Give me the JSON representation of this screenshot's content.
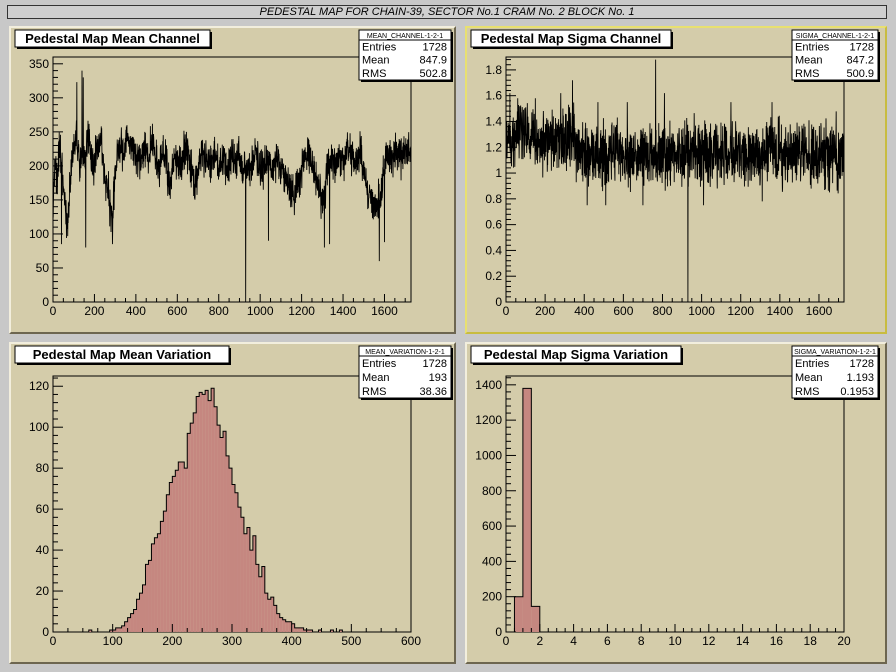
{
  "canvas_title": "PEDESTAL MAP FOR CHAIN-39, SECTOR No.1 CRAM No. 2 BLOCK No. 1",
  "colors": {
    "pad_bg": "#d4ccaa",
    "hist_fill": "#c58780",
    "line": "#000000",
    "selected_border": "#e8e070"
  },
  "chart_data": [
    {
      "type": "line",
      "title": "Pedestal Map Mean Channel",
      "stats": {
        "name": "MEAN_CHANNEL-1-2-1",
        "entries": "1728",
        "mean": "847.9",
        "rms": "502.8"
      },
      "xlim": [
        0,
        1728
      ],
      "ylim": [
        0,
        360
      ],
      "xticks": [
        0,
        200,
        400,
        600,
        800,
        1000,
        1200,
        1400,
        1600
      ],
      "yticks": [
        0,
        50,
        100,
        150,
        200,
        250,
        300,
        350
      ],
      "anchors": [
        [
          0,
          140
        ],
        [
          10,
          215
        ],
        [
          20,
          160
        ],
        [
          30,
          230
        ],
        [
          40,
          200
        ],
        [
          55,
          150
        ],
        [
          70,
          120
        ],
        [
          90,
          205
        ],
        [
          110,
          240
        ],
        [
          130,
          200
        ],
        [
          150,
          215
        ],
        [
          170,
          240
        ],
        [
          190,
          200
        ],
        [
          210,
          220
        ],
        [
          230,
          245
        ],
        [
          250,
          180
        ],
        [
          270,
          160
        ],
        [
          285,
          115
        ],
        [
          300,
          190
        ],
        [
          320,
          230
        ],
        [
          340,
          215
        ],
        [
          360,
          245
        ],
        [
          380,
          230
        ],
        [
          400,
          220
        ],
        [
          420,
          205
        ],
        [
          440,
          230
        ],
        [
          460,
          210
        ],
        [
          480,
          245
        ],
        [
          500,
          200
        ],
        [
          520,
          210
        ],
        [
          540,
          225
        ],
        [
          560,
          170
        ],
        [
          580,
          200
        ],
        [
          600,
          215
        ],
        [
          620,
          195
        ],
        [
          640,
          230
        ],
        [
          660,
          205
        ],
        [
          680,
          175
        ],
        [
          700,
          190
        ],
        [
          720,
          225
        ],
        [
          740,
          215
        ],
        [
          760,
          205
        ],
        [
          780,
          225
        ],
        [
          800,
          200
        ],
        [
          820,
          215
        ],
        [
          840,
          190
        ],
        [
          860,
          210
        ],
        [
          880,
          205
        ],
        [
          900,
          215
        ],
        [
          920,
          190
        ],
        [
          940,
          205
        ],
        [
          960,
          200
        ],
        [
          980,
          220
        ],
        [
          1000,
          195
        ],
        [
          1020,
          200
        ],
        [
          1040,
          210
        ],
        [
          1060,
          190
        ],
        [
          1080,
          215
        ],
        [
          1100,
          195
        ],
        [
          1120,
          180
        ],
        [
          1140,
          175
        ],
        [
          1160,
          155
        ],
        [
          1180,
          170
        ],
        [
          1200,
          195
        ],
        [
          1220,
          210
        ],
        [
          1240,
          215
        ],
        [
          1260,
          190
        ],
        [
          1280,
          175
        ],
        [
          1300,
          150
        ],
        [
          1320,
          180
        ],
        [
          1340,
          210
        ],
        [
          1360,
          200
        ],
        [
          1380,
          220
        ],
        [
          1400,
          205
        ],
        [
          1420,
          225
        ],
        [
          1440,
          215
        ],
        [
          1460,
          205
        ],
        [
          1480,
          220
        ],
        [
          1500,
          195
        ],
        [
          1520,
          160
        ],
        [
          1540,
          150
        ],
        [
          1560,
          135
        ],
        [
          1580,
          165
        ],
        [
          1600,
          200
        ],
        [
          1620,
          215
        ],
        [
          1640,
          210
        ],
        [
          1660,
          225
        ],
        [
          1680,
          215
        ],
        [
          1700,
          225
        ],
        [
          1728,
          220
        ]
      ],
      "noise": 20,
      "spikes": [
        [
          41,
          85
        ],
        [
          115,
          323
        ],
        [
          140,
          340
        ],
        [
          146,
          330
        ],
        [
          158,
          80
        ],
        [
          287,
          85
        ],
        [
          930,
          0
        ],
        [
          1040,
          90
        ],
        [
          1310,
          80
        ],
        [
          1335,
          85
        ],
        [
          1575,
          60
        ],
        [
          1600,
          88
        ],
        [
          1650,
          235
        ]
      ]
    },
    {
      "type": "line",
      "title": "Pedestal Map Sigma Channel",
      "stats": {
        "name": "SIGMA_CHANNEL-1-2-1",
        "entries": "1728",
        "mean": "847.2",
        "rms": "500.9"
      },
      "xlim": [
        0,
        1728
      ],
      "ylim": [
        0,
        1.9
      ],
      "xticks": [
        0,
        200,
        400,
        600,
        800,
        1000,
        1200,
        1400,
        1600
      ],
      "yticks": [
        0,
        0.2,
        0.4,
        0.6,
        0.8,
        1,
        1.2,
        1.4,
        1.6,
        1.8
      ],
      "yticklabels": [
        "0",
        "0.2",
        "0.4",
        "0.6",
        "0.8",
        "1",
        "1.2",
        "1.4",
        "1.6",
        "1.8"
      ],
      "anchors": [
        [
          0,
          1.25
        ],
        [
          100,
          1.3
        ],
        [
          200,
          1.25
        ],
        [
          300,
          1.25
        ],
        [
          350,
          1.25
        ],
        [
          380,
          1.15
        ],
        [
          500,
          1.15
        ],
        [
          700,
          1.15
        ],
        [
          900,
          1.15
        ],
        [
          1100,
          1.15
        ],
        [
          1300,
          1.15
        ],
        [
          1500,
          1.15
        ],
        [
          1728,
          1.15
        ]
      ],
      "noise": 0.17,
      "spikes": [
        [
          20,
          1.62
        ],
        [
          60,
          1.58
        ],
        [
          150,
          1.58
        ],
        [
          280,
          1.62
        ],
        [
          340,
          1.72
        ],
        [
          415,
          0.75
        ],
        [
          470,
          1.55
        ],
        [
          510,
          0.75
        ],
        [
          620,
          1.55
        ],
        [
          700,
          0.75
        ],
        [
          765,
          1.88
        ],
        [
          810,
          1.62
        ],
        [
          930,
          0
        ],
        [
          1010,
          0.75
        ],
        [
          1080,
          0.88
        ],
        [
          1150,
          1.55
        ],
        [
          1310,
          0.78
        ],
        [
          1360,
          1.55
        ]
      ]
    },
    {
      "type": "histogram",
      "title": "Pedestal Map Mean Variation",
      "stats": {
        "name": "MEAN_VARIATION-1-2-1",
        "entries": "1728",
        "mean": "193",
        "rms": "38.36"
      },
      "xlim": [
        0,
        600
      ],
      "ylim": [
        0,
        125
      ],
      "xticks": [
        0,
        100,
        200,
        300,
        400,
        500,
        600
      ],
      "yticks": [
        0,
        20,
        40,
        60,
        80,
        100,
        120
      ],
      "bin_start": 60,
      "bin_width": 5,
      "values": [
        1,
        0,
        0,
        0,
        0,
        0,
        0,
        1,
        1,
        2,
        2,
        3,
        5,
        7,
        9,
        11,
        16,
        19,
        23,
        33,
        35,
        43,
        46,
        48,
        54,
        59,
        67,
        73,
        76,
        79,
        83,
        83,
        80,
        97,
        102,
        107,
        115,
        117,
        116,
        118,
        113,
        119,
        110,
        101,
        95,
        98,
        86,
        80,
        72,
        68,
        61,
        56,
        48,
        51,
        40,
        47,
        33,
        27,
        32,
        19,
        16,
        17,
        13,
        9,
        7,
        6,
        5,
        5,
        4,
        2,
        2,
        2,
        1,
        1,
        1,
        0,
        0,
        1,
        0,
        0,
        0,
        1,
        0,
        0,
        1
      ]
    },
    {
      "type": "histogram",
      "title": "Pedestal Map Sigma Variation",
      "stats": {
        "name": "SIGMA_VARIATION-1-2-1",
        "entries": "1728",
        "mean": "1.193",
        "rms": "0.1953"
      },
      "xlim": [
        0,
        20
      ],
      "ylim": [
        0,
        1450
      ],
      "xticks": [
        0,
        2,
        4,
        6,
        8,
        10,
        12,
        14,
        16,
        18,
        20
      ],
      "yticks": [
        0,
        200,
        400,
        600,
        800,
        1000,
        1200,
        1400
      ],
      "bin_start": 0,
      "bin_width": 0.5,
      "values": [
        0,
        200,
        1380,
        145
      ]
    }
  ]
}
